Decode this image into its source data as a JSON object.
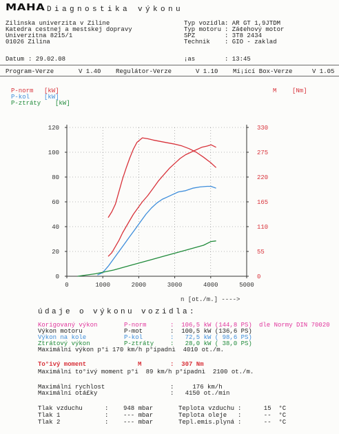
{
  "header": {
    "logo": "MAHA",
    "title": "Diagnostika výkonu",
    "address": [
      "Zilinska univerzita v Ziline",
      "Katedra cestnej a mestskej dopravy",
      "Univerzitna 8215/1",
      "01026 Zilina"
    ],
    "vehicle": [
      {
        "label": "Typ vozidla",
        "value": ": AR GT 1,9JTDM"
      },
      {
        "label": "Typ motoru",
        "value": ": Zá¢ehový motor"
      },
      {
        "label": "SPZ",
        "value": ": 3T8 2434"
      },
      {
        "label": "Technik",
        "value": ": GIO - zaklad"
      }
    ],
    "date": {
      "label": "Datum",
      "value": ": 29.02.08"
    },
    "time": {
      "label": "¡as",
      "value": ": 13:45"
    }
  },
  "versions": [
    {
      "label": "Program-Verze",
      "value": "V 1.40"
    },
    {
      "label": "Regulátor-Verze",
      "value": "V 1.10"
    },
    {
      "label": "Mí¡ící Box-Verze",
      "value": "V 1.05"
    }
  ],
  "colors": {
    "red": "#d8323a",
    "blue": "#3d8ddb",
    "green": "#1f8a3a",
    "magenta": "#e0359c",
    "text": "#222222"
  },
  "chart_data": {
    "type": "line",
    "xlabel": "n [ot./m.]  ---->",
    "xlim": [
      0,
      5000
    ],
    "xticks": [
      0,
      1000,
      2000,
      3000,
      4000,
      5000
    ],
    "ylim": [
      0,
      120
    ],
    "yticks": [
      0,
      20,
      40,
      60,
      80,
      100,
      120
    ],
    "y2lim": [
      0,
      330
    ],
    "y2ticks": [
      0,
      55,
      110,
      165,
      220,
      275,
      330
    ],
    "grid": true,
    "legend": "top",
    "series": [
      {
        "name": "P-norm",
        "unit": "[kW]",
        "axis": "left",
        "color": "#d8323a",
        "x": [
          1150,
          1250,
          1350,
          1450,
          1550,
          1650,
          1750,
          1850,
          1950,
          2100,
          2250,
          2400,
          2550,
          2700,
          2850,
          3000,
          3150,
          3300,
          3450,
          3600,
          3750,
          3900,
          4010,
          4150
        ],
        "y": [
          16,
          19,
          24,
          29,
          35,
          40,
          45,
          50,
          54,
          60,
          65,
          71,
          77,
          82,
          87,
          91,
          95,
          98,
          100,
          102,
          104,
          105,
          106,
          104
        ]
      },
      {
        "name": "P-kol",
        "unit": "[kW]",
        "axis": "left",
        "color": "#3d8ddb",
        "x": [
          850,
          1000,
          1150,
          1300,
          1450,
          1600,
          1750,
          1900,
          2050,
          2200,
          2350,
          2500,
          2650,
          2800,
          2950,
          3100,
          3300,
          3500,
          3700,
          3900,
          4010,
          4150
        ],
        "y": [
          1,
          3,
          8,
          14,
          20,
          26,
          32,
          38,
          44,
          50,
          55,
          59,
          62,
          64,
          66,
          68,
          69,
          71,
          72,
          72.5,
          72.5,
          71
        ]
      },
      {
        "name": "P-ztráty",
        "unit": "[kW]",
        "axis": "left",
        "color": "#1f8a3a",
        "x": [
          300,
          800,
          1300,
          1800,
          2300,
          2800,
          3300,
          3800,
          4010,
          4150
        ],
        "y": [
          0,
          2,
          5,
          9,
          13,
          17,
          21,
          25,
          28,
          28.5
        ]
      },
      {
        "name": "M",
        "unit": "[Nm]",
        "axis": "right",
        "color": "#d8323a",
        "x": [
          1150,
          1250,
          1350,
          1450,
          1550,
          1650,
          1750,
          1850,
          1950,
          2100,
          2250,
          2400,
          2600,
          2800,
          3000,
          3200,
          3400,
          3600,
          3800,
          4000,
          4150
        ],
        "y": [
          130,
          143,
          160,
          188,
          216,
          240,
          262,
          282,
          297,
          307,
          305,
          302,
          299,
          296,
          293,
          289,
          283,
          275,
          264,
          252,
          241
        ]
      }
    ]
  },
  "results": {
    "title": "údaje o výkonu vozidla:",
    "power_rows": [
      {
        "label": "Korigovaný výkon",
        "code": "P-norm",
        "value": ":  106,5 kW (144,8 PS)",
        "note": "dle Normy DIN 70020",
        "color": "#e0359c"
      },
      {
        "label": "Výkon motoru",
        "code": "P-mot",
        "value": ":  100,5 kW (136,6 PS)",
        "note": "",
        "color": "#222222"
      },
      {
        "label": "Výkon na kole",
        "code": "P-kol",
        "value": ":   72,5 kW ( 98,6 PS)",
        "note": "",
        "color": "#3d8ddb"
      },
      {
        "label": "Ztrátový výkon",
        "code": "P-ztráty",
        "value": ":   28,0 kW ( 38,0 PS)",
        "note": "",
        "color": "#1f8a3a"
      }
    ],
    "max_power_line": "Maximální výkon p°i 170 km/h p°ípadnì  4010 ot./m.",
    "torque": {
      "label": "To°ivý moment",
      "code": "M",
      "value": ":  307 Nm",
      "color": "#d8323a"
    },
    "max_torque_line": "Maximální to°ivý moment p°i  89 km/h p°ípadnì  2100 ot./m.",
    "max_speed": {
      "label": "Maximální rychlost",
      "value": ":     176 km/h"
    },
    "max_rpm": {
      "label": "Maximální otá£ky",
      "value": ":   4150 ot./min"
    },
    "conditions": [
      {
        "label": "Tlak vzduchu",
        "value": ":    948 mbar",
        "temp_label": "Teplota vzduchu",
        "temp_value": ":      15  °C"
      },
      {
        "label": "Tlak 1",
        "value": ":    --- mbar",
        "temp_label": "Teplota oleje",
        "temp_value": ":      --  °C"
      },
      {
        "label": "Tlak 2",
        "value": ":    --- mbar",
        "temp_label": "Tepl.emis.plyná",
        "temp_value": ":      --  °C"
      }
    ]
  }
}
